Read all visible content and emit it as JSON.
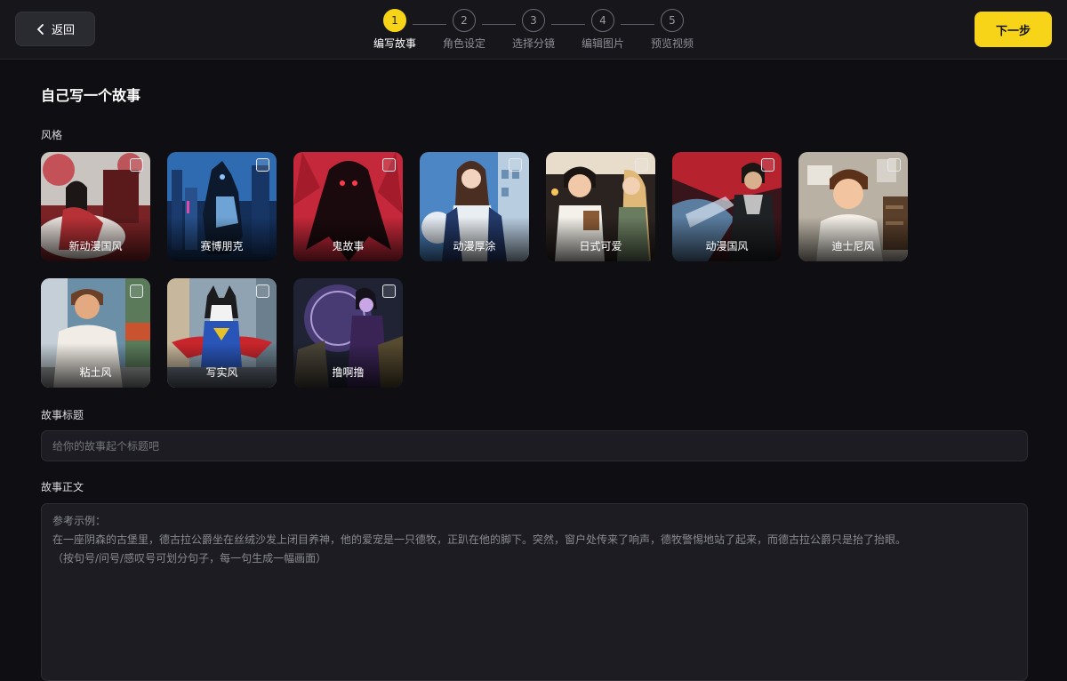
{
  "header": {
    "back_label": "返回",
    "next_label": "下一步",
    "steps": [
      {
        "num": "1",
        "label": "编写故事",
        "active": true
      },
      {
        "num": "2",
        "label": "角色设定",
        "active": false
      },
      {
        "num": "3",
        "label": "选择分镜",
        "active": false
      },
      {
        "num": "4",
        "label": "编辑图片",
        "active": false
      },
      {
        "num": "5",
        "label": "预览视频",
        "active": false
      }
    ]
  },
  "main": {
    "title": "自己写一个故事",
    "style_label": "风格",
    "styles": [
      {
        "label": "新动漫国风",
        "checked": false
      },
      {
        "label": "赛博朋克",
        "checked": false
      },
      {
        "label": "鬼故事",
        "checked": false
      },
      {
        "label": "动漫厚涂",
        "checked": false
      },
      {
        "label": "日式可爱",
        "checked": false
      },
      {
        "label": "动漫国风",
        "checked": false
      },
      {
        "label": "迪士尼风",
        "checked": false
      },
      {
        "label": "粘土风",
        "checked": false
      },
      {
        "label": "写实风",
        "checked": false
      },
      {
        "label": "撸啊撸",
        "checked": false
      }
    ],
    "story_title_label": "故事标题",
    "story_title_placeholder": "给你的故事起个标题吧",
    "story_title_value": "",
    "story_body_label": "故事正文",
    "story_body_placeholder_lines": [
      "参考示例：",
      "在一座阴森的古堡里，德古拉公爵坐在丝绒沙发上闭目养神，他的爱宠是一只德牧，正趴在他的脚下。突然，窗户处传来了响声，德牧警惕地站了起来，而德古拉公爵只是抬了抬眼。",
      "（按句号/问号/感叹号可划分句子，每一句生成一幅画面）"
    ]
  },
  "colors": {
    "accent": "#f7d417",
    "background": "#0f0f13",
    "header_bg": "#16161b",
    "input_bg": "#1c1c22"
  }
}
